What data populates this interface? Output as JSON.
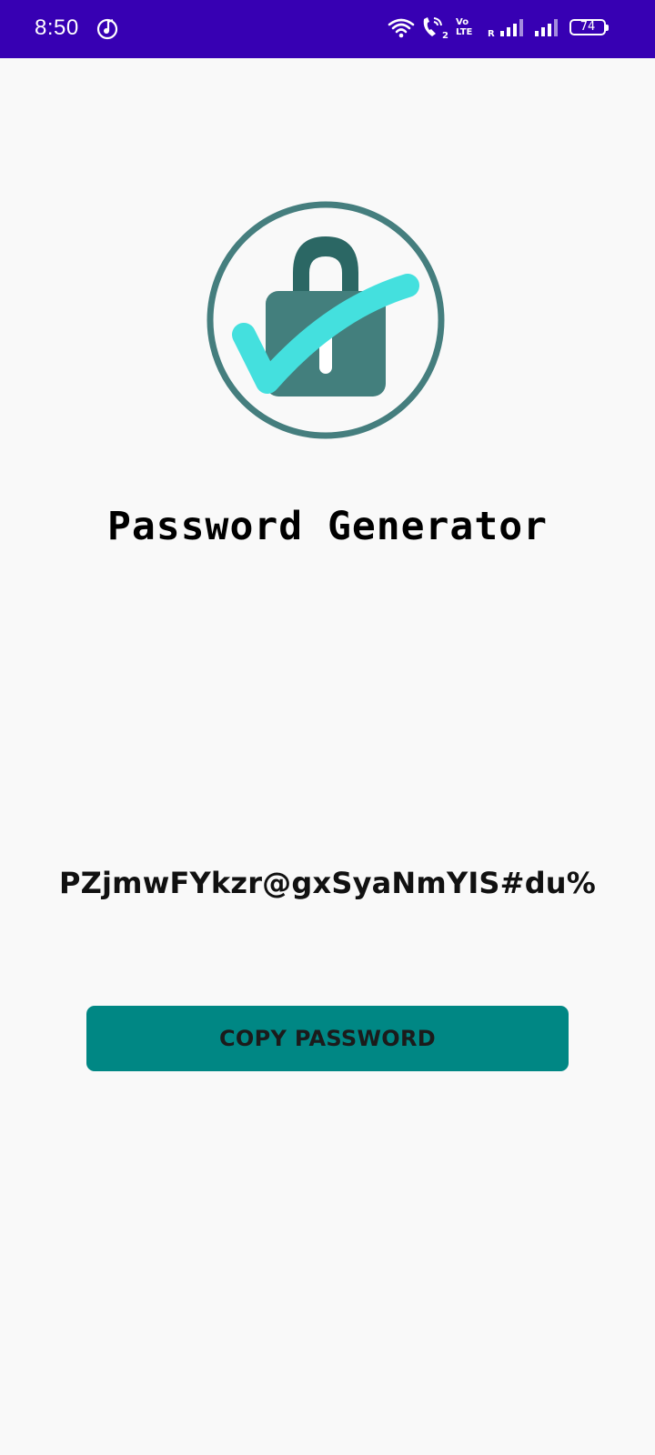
{
  "status_bar": {
    "time": "8:50",
    "battery": "74",
    "roaming_indicator": "R",
    "volte": "Vo LTE",
    "background": "#3700b3",
    "icons": [
      "music-icon",
      "wifi-icon",
      "call-icon",
      "volte-icon",
      "signal-icon",
      "signal-icon-2",
      "battery-icon"
    ]
  },
  "app": {
    "title": "Password Generator",
    "password": "PZjmwFYkzr@gxSyaNmYIS#du%",
    "copy_button_label": "COPY PASSWORD",
    "logo_icon": "lock-check-icon",
    "colors": {
      "accent": "#008784",
      "lock": "#437f7d",
      "lock_shackle": "#2b6764",
      "check": "#44e0de",
      "ring": "#457e7e"
    }
  }
}
